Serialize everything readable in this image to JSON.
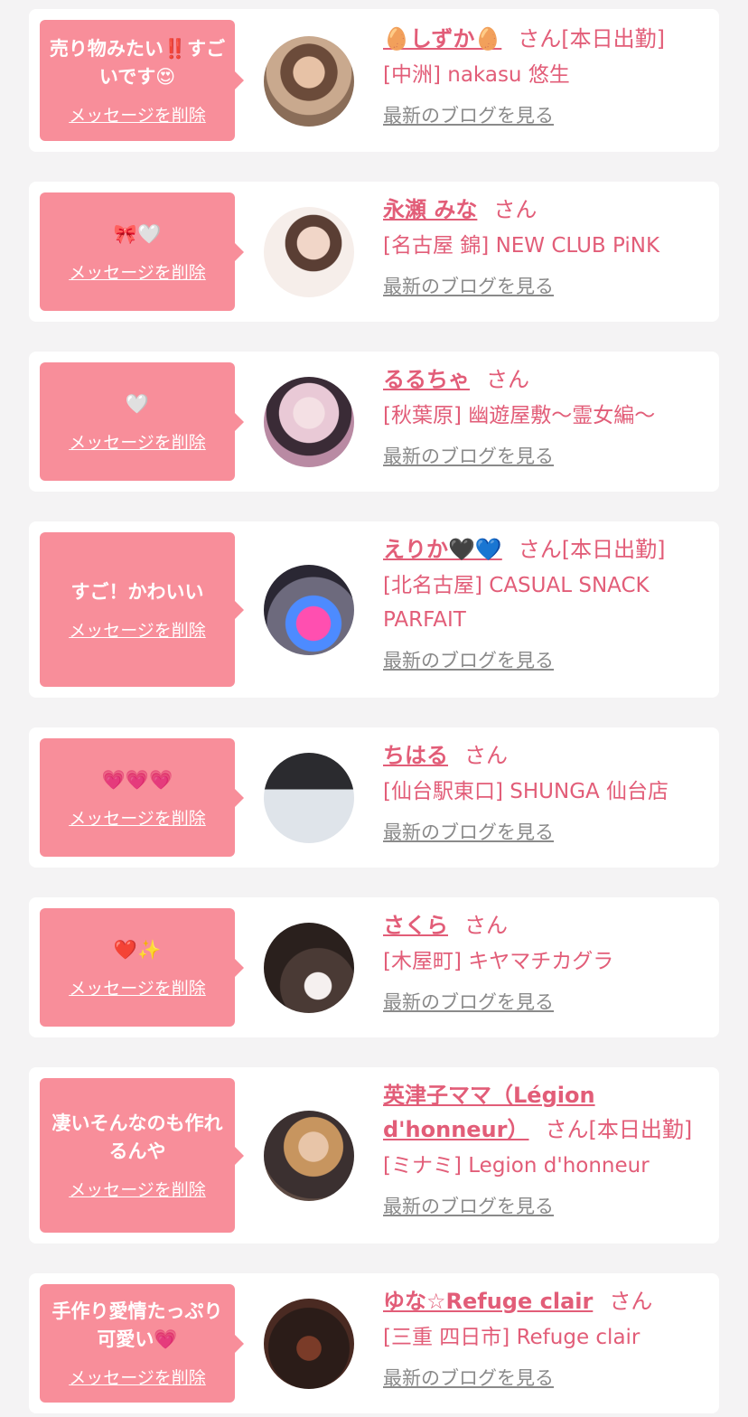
{
  "delete_label": "メッセージを削除",
  "blog_label": "最新のブログを見る",
  "san_label": "さん",
  "theme": {
    "bubble": "#f88e9a",
    "link": "#e25d78",
    "muted": "#8a8a8a"
  },
  "entries": [
    {
      "message": "売り物みたい‼️すごいです😍",
      "name": "🥚しずか🥚",
      "suffix": "[本日出勤]",
      "shop": "[中洲] nakasu 悠生"
    },
    {
      "message": "🎀🤍",
      "name": "永瀬 みな",
      "suffix": "",
      "shop": "[名古屋 錦] NEW CLUB PiNK"
    },
    {
      "message": "🤍",
      "name": "るるちゃ",
      "suffix": "",
      "shop": "[秋葉原] 幽遊屋敷〜霊女編〜"
    },
    {
      "message": "すご！かわいい",
      "name": "えりか🖤💙",
      "suffix": "[本日出勤]",
      "shop": "[北名古屋] CASUAL SNACK PARFAIT"
    },
    {
      "message": "💗💗💗",
      "name": "ちはる",
      "suffix": "",
      "shop": "[仙台駅東口] SHUNGA 仙台店"
    },
    {
      "message": "❤️✨",
      "name": "さくら",
      "suffix": "",
      "shop": "[木屋町] キヤマチカグラ"
    },
    {
      "message": "凄いそんなのも作れるんや",
      "name": "英津子ママ（Légion d'honneur）",
      "suffix": "[本日出勤]",
      "shop": "[ミナミ] Legion d'honneur"
    },
    {
      "message": "手作り愛情たっぷり可愛い💗",
      "name": "ゆな☆Refuge clair",
      "suffix": "",
      "shop": "[三重 四日市] Refuge clair"
    }
  ]
}
